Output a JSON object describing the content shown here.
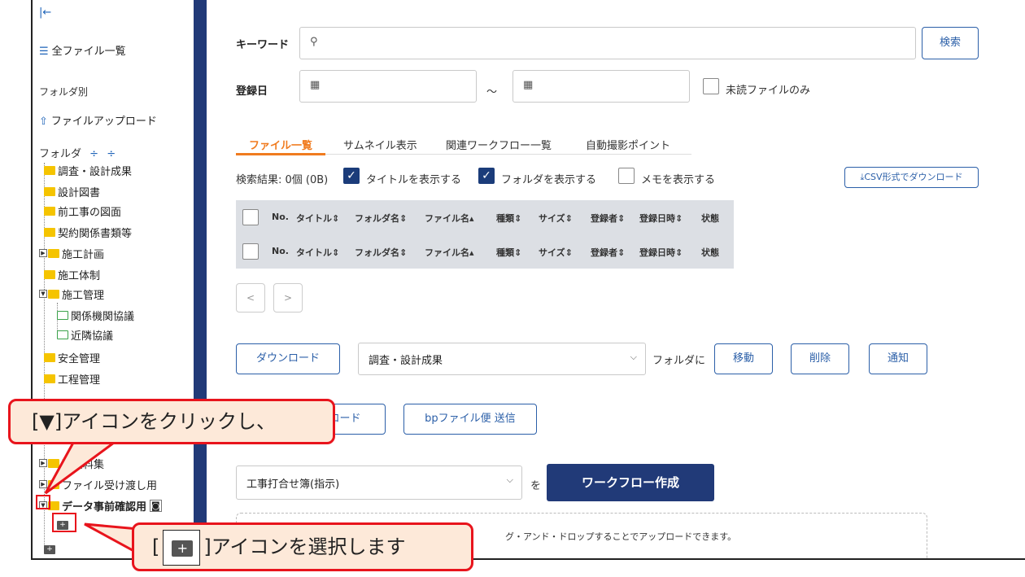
{
  "sidebar": {
    "collapse_icon": "collapse-left-icon",
    "all_files": "全ファイル一覧",
    "by_folder": "フォルダ別",
    "upload": "ファイルアップロード",
    "folder_label": "フォルダ",
    "folders": [
      {
        "label": "調査・設計成果"
      },
      {
        "label": "設計図書"
      },
      {
        "label": "前工事の図面"
      },
      {
        "label": "契約関係書類等"
      },
      {
        "label": "施工計画"
      },
      {
        "label": "施工体制"
      },
      {
        "label": "施工管理"
      },
      {
        "label": "関係機関協議"
      },
      {
        "label": "近隣協議"
      },
      {
        "label": "安全管理"
      },
      {
        "label": "工程管理"
      },
      {
        "label": "理資料集"
      },
      {
        "label": "ファイル受け渡し用"
      },
      {
        "label": "データ事前確認用"
      }
    ]
  },
  "search": {
    "keyword_label": "キーワード",
    "keyword_value": "",
    "search_button": "検索",
    "date_label": "登録日",
    "date_sep": "～",
    "unread_only": "未読ファイルのみ"
  },
  "tabs": [
    "ファイル一覧",
    "サムネイル表示",
    "関連ワークフロー一覧",
    "自動撮影ポイント"
  ],
  "results": {
    "count_text": "検索結果: 0個 (0B)",
    "show_title": "タイトルを表示する",
    "show_folder": "フォルダを表示する",
    "show_memo": "メモを表示する",
    "csv_button": "CSV形式でダウンロード"
  },
  "table": {
    "headers": [
      "No.",
      "タイトル",
      "フォルダ名",
      "ファイル名",
      "種類",
      "サイズ",
      "登録者",
      "登録日時",
      "状態"
    ]
  },
  "pager": {
    "prev": "<",
    "next": ">"
  },
  "actions": {
    "download": "ダウンロード",
    "folder_select": "調査・設計成果",
    "folder_suffix": "フォルダに",
    "move": "移動",
    "delete": "削除",
    "notify": "通知",
    "upload_partial": "ロード",
    "bp_send": "bpファイル便 送信"
  },
  "workflow": {
    "select_value": "工事打合せ簿(指示)",
    "particle": "を",
    "create_button": "ワークフロー作成"
  },
  "dropzone_text": "グ・アンド・ドロップすることでアップロードできます。",
  "callouts": {
    "first": "[▼]アイコンをクリックし、",
    "second_pre": "[",
    "second_post": "]アイコンを選択します"
  },
  "colors": {
    "accent": "#213a78",
    "tab_active": "#f07b1f",
    "callout_border": "#e8141c",
    "callout_fill": "#fde9d9"
  }
}
